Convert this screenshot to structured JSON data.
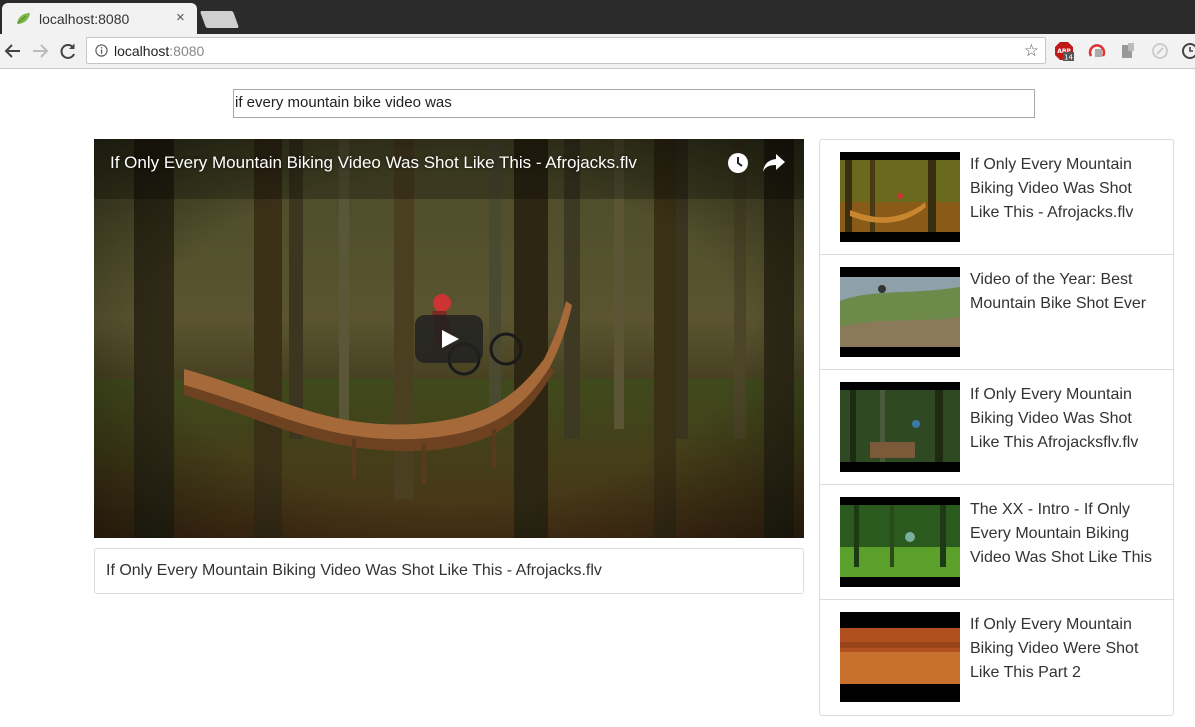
{
  "browser": {
    "tab_title": "localhost:8080",
    "tab_close": "×",
    "url_host": "localhost",
    "url_port": ":8080",
    "abp_badge": "14"
  },
  "search": {
    "value": "if every mountain bike video was"
  },
  "player": {
    "title": "If Only Every Mountain Biking Video Was Shot Like This - Afrojacks.flv"
  },
  "caption": {
    "text": "If Only Every Mountain Biking Video Was Shot Like This - Afrojacks.flv"
  },
  "results": [
    {
      "title": "If Only Every Mountain Biking Video Was Shot Like This - Afrojacks.flv"
    },
    {
      "title": "Video of the Year: Best Mountain Bike Shot Ever"
    },
    {
      "title": "If Only Every Mountain Biking Video Was Shot Like This Afrojacksflv.flv"
    },
    {
      "title": "The XX - Intro - If Only Every Mountain Biking Video Was Shot Like This"
    },
    {
      "title": "If Only Every Mountain Biking Video Were Shot Like This Part 2"
    }
  ]
}
